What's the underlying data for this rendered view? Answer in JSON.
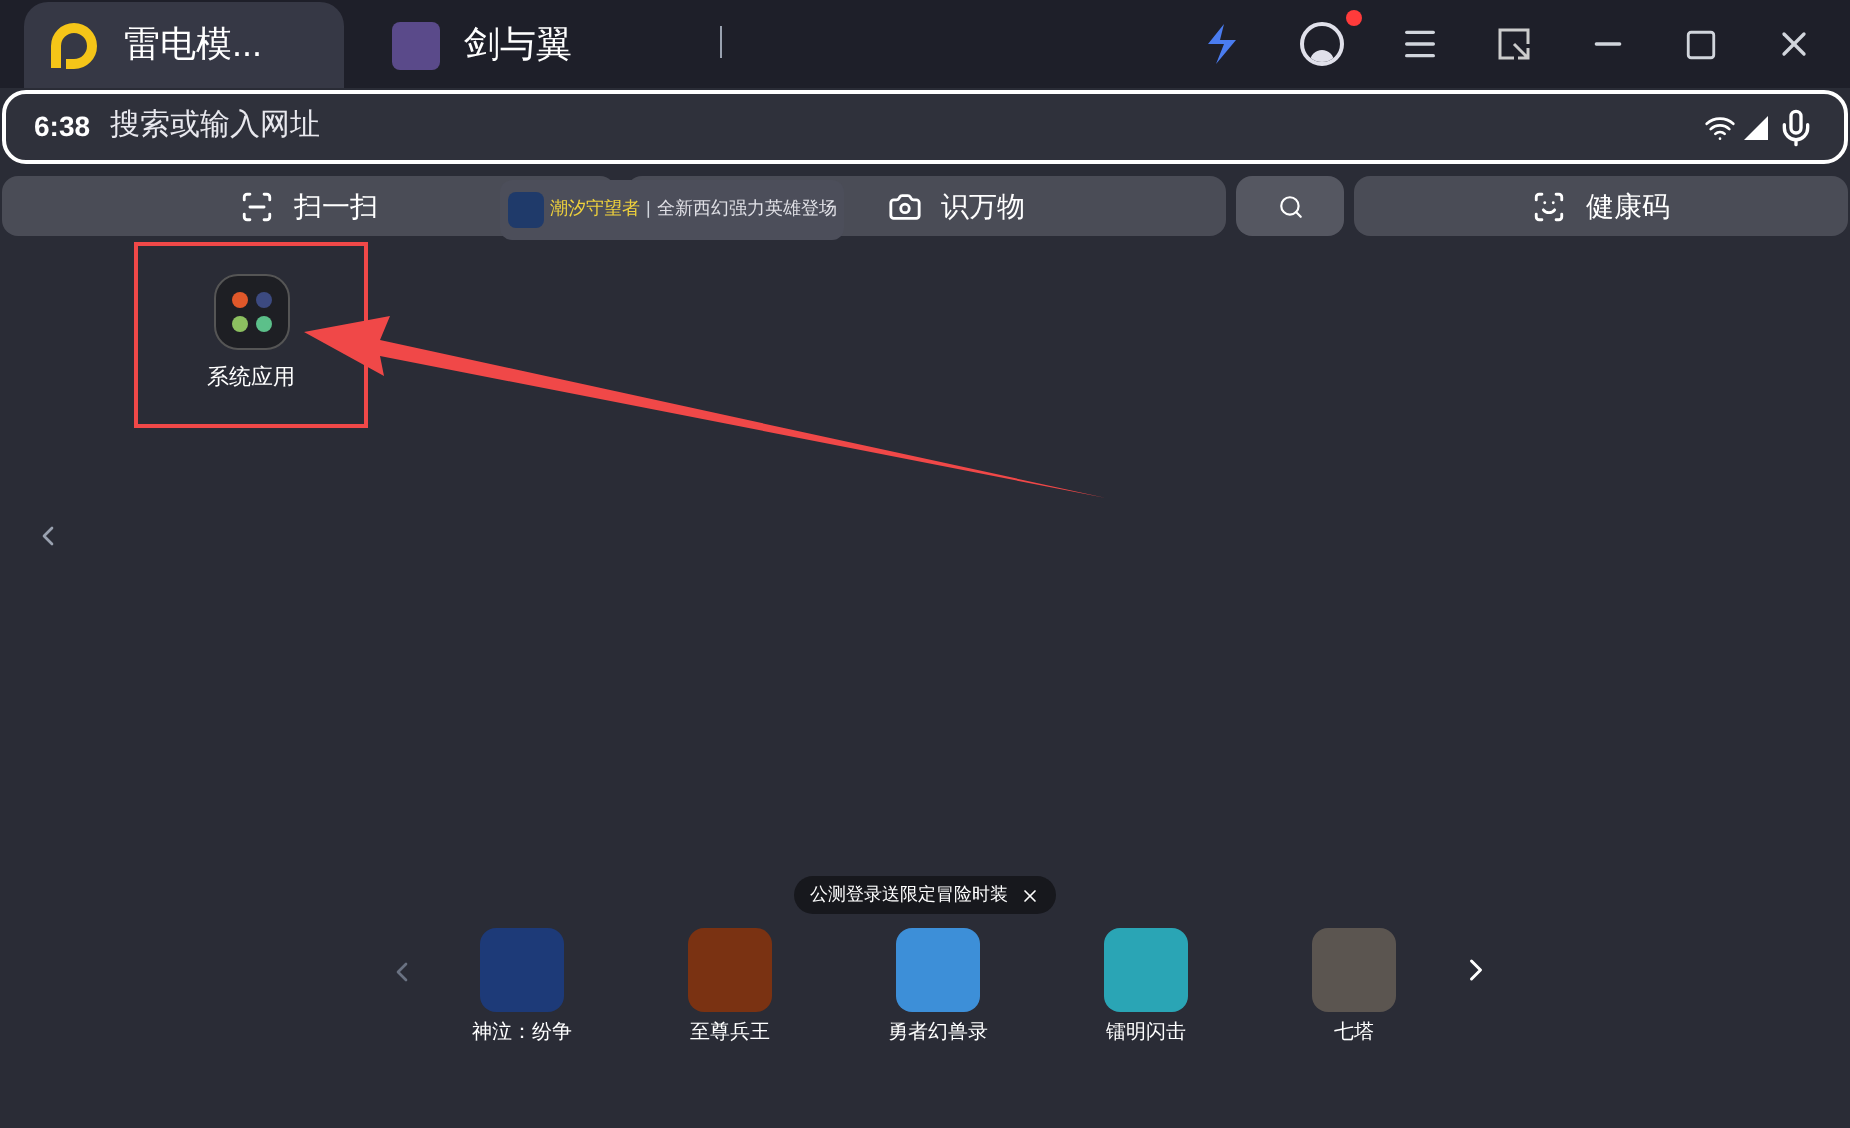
{
  "tabs": [
    {
      "label": "雷电模...",
      "kind": "app",
      "selected": true
    },
    {
      "label": "剑与翼",
      "kind": "game",
      "selected": false
    }
  ],
  "account": {
    "notification": true
  },
  "search": {
    "time": "6:38",
    "placeholder": "搜索或输入网址"
  },
  "quick_actions": [
    {
      "label": "扫一扫",
      "kind": "scan"
    },
    {
      "label": "识万物",
      "kind": "camera"
    },
    {
      "kind": "search"
    },
    {
      "label": "健康码",
      "kind": "health"
    }
  ],
  "ad_banner": {
    "title": "潮汐守望者",
    "separator": "|",
    "text": "全新西幻强力英雄登场"
  },
  "desktop": {
    "folder": {
      "label": "系统应用"
    }
  },
  "carousel": {
    "tooltip": "公测登录送限定冒险时装",
    "games": [
      {
        "name": "神泣：纷争"
      },
      {
        "name": "至尊兵王"
      },
      {
        "name": "勇者幻兽录"
      },
      {
        "name": "镭明闪击"
      },
      {
        "name": "七塔"
      }
    ]
  }
}
